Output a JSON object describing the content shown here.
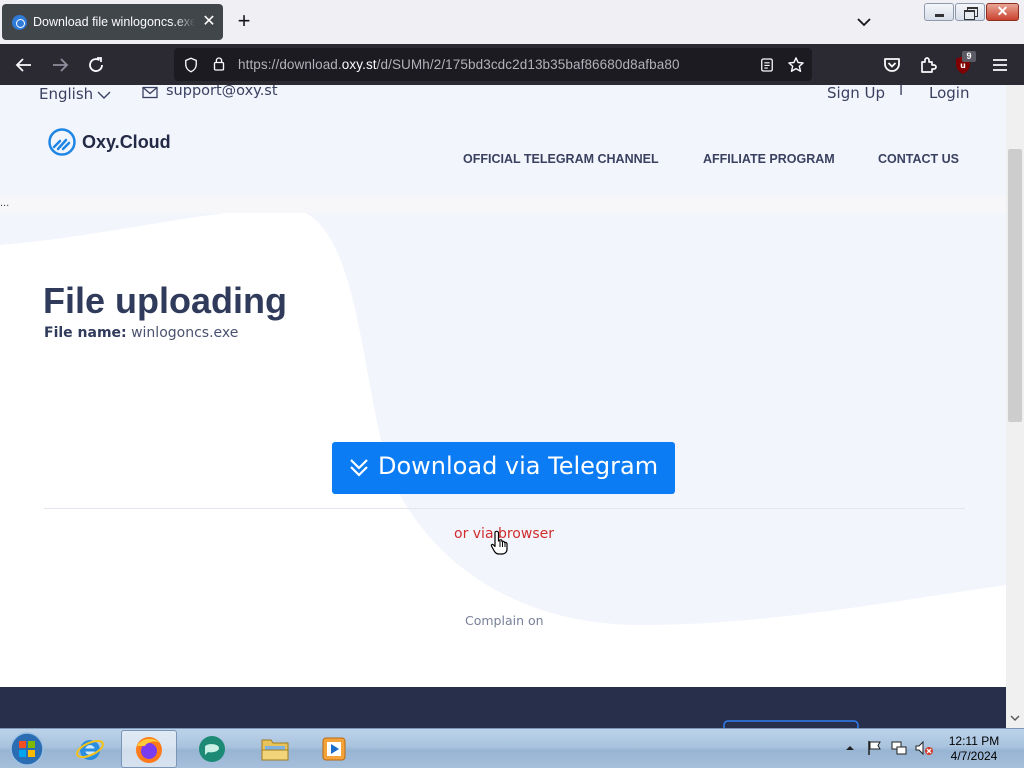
{
  "browser": {
    "tab_title": "Download file winlogoncs.exe on Oxy.Cloud",
    "new_tab_symbol": "+",
    "close_tab_symbol": "✕",
    "url_prefix": "https://download.",
    "url_domain": "oxy.st",
    "url_path": "/d/SUMh/2/175bd3cdc2d13b35baf86680d8afba80",
    "extension_badge": "9",
    "close_window_symbol": "✕",
    "icons": [
      "back-icon",
      "forward-icon",
      "reload-icon",
      "tracking-shield-icon",
      "lock-icon",
      "reader-view-icon",
      "bookmark-star-icon",
      "pocket-icon",
      "extensions-icon",
      "ublock-icon",
      "menu-icon",
      "tab-list-icon"
    ]
  },
  "topbar": {
    "language": "English",
    "email": "support@oxy.st",
    "sign_up": "Sign Up",
    "separator": "I",
    "login": "Login"
  },
  "header": {
    "logo_text": "Oxy.Cloud",
    "nav": [
      "OFFICIAL TELEGRAM CHANNEL",
      "AFFILIATE PROGRAM",
      "CONTACT US"
    ]
  },
  "main": {
    "ellipsis": "...",
    "heading": "File uploading",
    "file_label": "File name:",
    "file_name": "winlogoncs.exe",
    "download_button": "Download via Telegram",
    "browser_link": "or via browser",
    "complain_text": "Complain on"
  },
  "taskbar": {
    "apps": [
      "start-orb",
      "internet-explorer",
      "firefox",
      "chat-app",
      "file-explorer",
      "media-player"
    ],
    "time": "12:11 PM",
    "date": "4/7/2024"
  },
  "colors": {
    "accent_blue": "#0b7cf4",
    "heading_navy": "#303b5b",
    "link_red": "#d02d2d",
    "footer_navy": "#272f4b",
    "browser_dark": "#2b2a33"
  }
}
